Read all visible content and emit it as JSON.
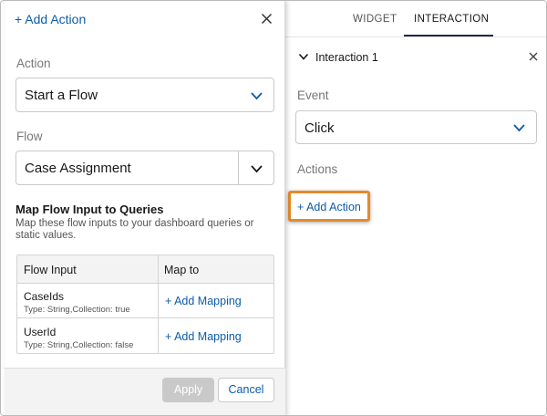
{
  "left_panel": {
    "title": "+ Add Action",
    "action_label": "Action",
    "action_value": "Start a Flow",
    "flow_label": "Flow",
    "flow_value": "Case Assignment",
    "map_title": "Map Flow Input to Queries",
    "map_description": "Map these flow inputs to your dashboard queries or static values.",
    "table": {
      "headers": [
        "Flow Input",
        "Map to"
      ],
      "rows": [
        {
          "name": "CaseIds",
          "type": "Type: String,Collection: true",
          "action": "+ Add Mapping"
        },
        {
          "name": "UserId",
          "type": "Type: String,Collection: false",
          "action": "+ Add Mapping"
        }
      ]
    },
    "apply_label": "Apply",
    "cancel_label": "Cancel"
  },
  "right_panel": {
    "tabs": [
      {
        "label": "WIDGET",
        "active": false
      },
      {
        "label": "INTERACTION",
        "active": true
      }
    ],
    "interaction_title": "Interaction 1",
    "event_label": "Event",
    "event_value": "Click",
    "actions_label": "Actions",
    "add_action_label": "+ Add Action"
  },
  "colors": {
    "link": "#0b5cab",
    "highlight_border": "#e58a2b",
    "tab_underline": "#1b2b4b",
    "disabled_button": "#c9c9c9"
  },
  "icons": {
    "close": "close-icon",
    "chevron_down": "chevron-down-icon"
  }
}
